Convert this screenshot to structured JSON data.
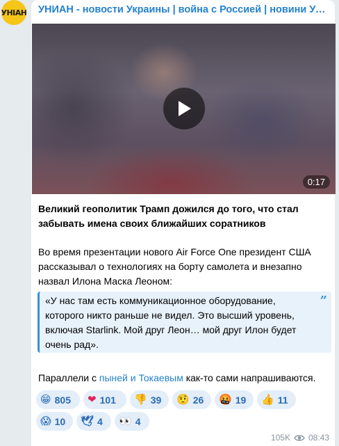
{
  "channel": {
    "name": "УНИАН - новости Украины | война с Россией | новини Україні…",
    "avatar_text": "УНІАН",
    "brand_color": "#f5c518"
  },
  "video": {
    "duration": "0:17",
    "play_icon": "play-icon"
  },
  "post": {
    "headline_line1": "Великий геополитик Трамп дожился до того, что стал",
    "headline_line2": "забывать имена своих ближайших соратников",
    "para1_line1": "Во время презентации нового Air Force One президент США",
    "para1_line2": "рассказывал о технологиях на борту самолета и внезапно",
    "para1_line3": "назвал Илона Маска Леоном:",
    "quote_line1": "«У нас там есть коммуникационное оборудование,",
    "quote_line2": "которого никто раньше не видел. Это высший уровень,",
    "quote_line3": "включая Starlink. Мой друг Леон… мой друг Илон будет",
    "quote_line4": "очень рад».",
    "para2_before": "Параллели с ",
    "para2_link": "пыней и Токаевым",
    "para2_after": " как-то сами напрашиваются."
  },
  "reactions": [
    {
      "emoji": "😁",
      "count": "805"
    },
    {
      "emoji": "❤",
      "count": "101"
    },
    {
      "emoji": "👎",
      "count": "39"
    },
    {
      "emoji": "🤨",
      "count": "26"
    },
    {
      "emoji": "🤬",
      "count": "19"
    },
    {
      "emoji": "👍",
      "count": "11"
    },
    {
      "emoji": "😱",
      "count": "10"
    },
    {
      "emoji": "🕊",
      "count": "4"
    },
    {
      "emoji": "👀",
      "count": "4"
    }
  ],
  "meta": {
    "views": "105K",
    "time": "08:43"
  }
}
